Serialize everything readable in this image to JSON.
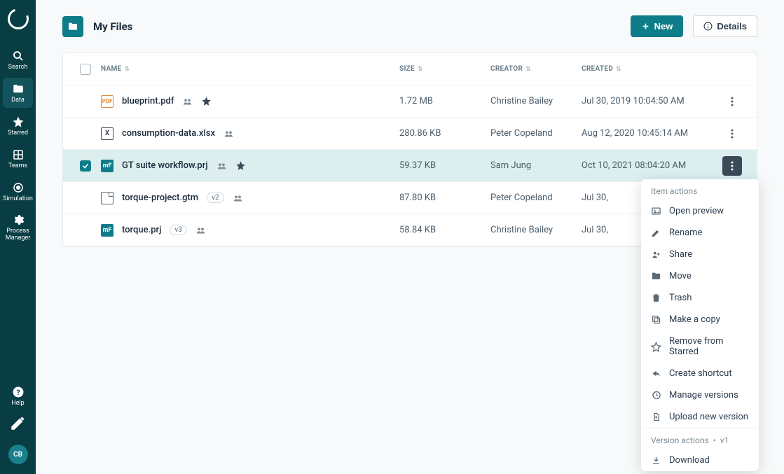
{
  "sidebar": {
    "items": [
      {
        "label": "Search"
      },
      {
        "label": "Data"
      },
      {
        "label": "Starred"
      },
      {
        "label": "Teams"
      },
      {
        "label": "Simulation"
      },
      {
        "label": "Process Manager"
      }
    ],
    "help": "Help",
    "avatar": "CB"
  },
  "header": {
    "title": "My Files",
    "new_button": "New",
    "details_button": "Details"
  },
  "columns": {
    "name": "NAME",
    "size": "SIZE",
    "creator": "CREATOR",
    "created": "CREATED"
  },
  "rows": [
    {
      "name": "blueprint.pdf",
      "size": "1.72 MB",
      "creator": "Christine Bailey",
      "created": "Jul 30, 2019 10:04:50 AM",
      "icon": "pdf",
      "shared": true,
      "starred": true,
      "selected": false
    },
    {
      "name": "consumption-data.xlsx",
      "size": "280.86 KB",
      "creator": "Peter Copeland",
      "created": "Aug 12, 2020 10:45:14 AM",
      "icon": "xlsx",
      "shared": true,
      "starred": false,
      "selected": false
    },
    {
      "name": "GT suite workflow.prj",
      "size": "59.37 KB",
      "creator": "Sam Jung",
      "created": "Oct 10, 2021 08:04:20 AM",
      "icon": "mf",
      "shared": true,
      "starred": true,
      "selected": true
    },
    {
      "name": "torque-project.gtm",
      "size": "87.80 KB",
      "creator": "Peter Copeland",
      "created": "Jul 30,",
      "icon": "doc",
      "version": "v2",
      "shared": true,
      "selected": false
    },
    {
      "name": "torque.prj",
      "size": "58.84 KB",
      "creator": "Christine Bailey",
      "created": "Jul 30,",
      "icon": "mf",
      "version": "v3",
      "shared": true,
      "selected": false
    }
  ],
  "context_menu": {
    "item_header": "Item actions",
    "items": [
      {
        "label": "Open preview",
        "icon": "image"
      },
      {
        "label": "Rename",
        "icon": "pencil"
      },
      {
        "label": "Share",
        "icon": "share"
      },
      {
        "label": "Move",
        "icon": "folder"
      },
      {
        "label": "Trash",
        "icon": "trash"
      },
      {
        "label": "Make a copy",
        "icon": "copy"
      },
      {
        "label": "Remove from Starred",
        "icon": "star"
      },
      {
        "label": "Create shortcut",
        "icon": "shortcut"
      },
      {
        "label": "Manage versions",
        "icon": "history"
      },
      {
        "label": "Upload new version",
        "icon": "upload"
      }
    ],
    "version_header": "Version actions",
    "version_tag": "v1",
    "version_items": [
      {
        "label": "Download",
        "icon": "download"
      }
    ]
  }
}
